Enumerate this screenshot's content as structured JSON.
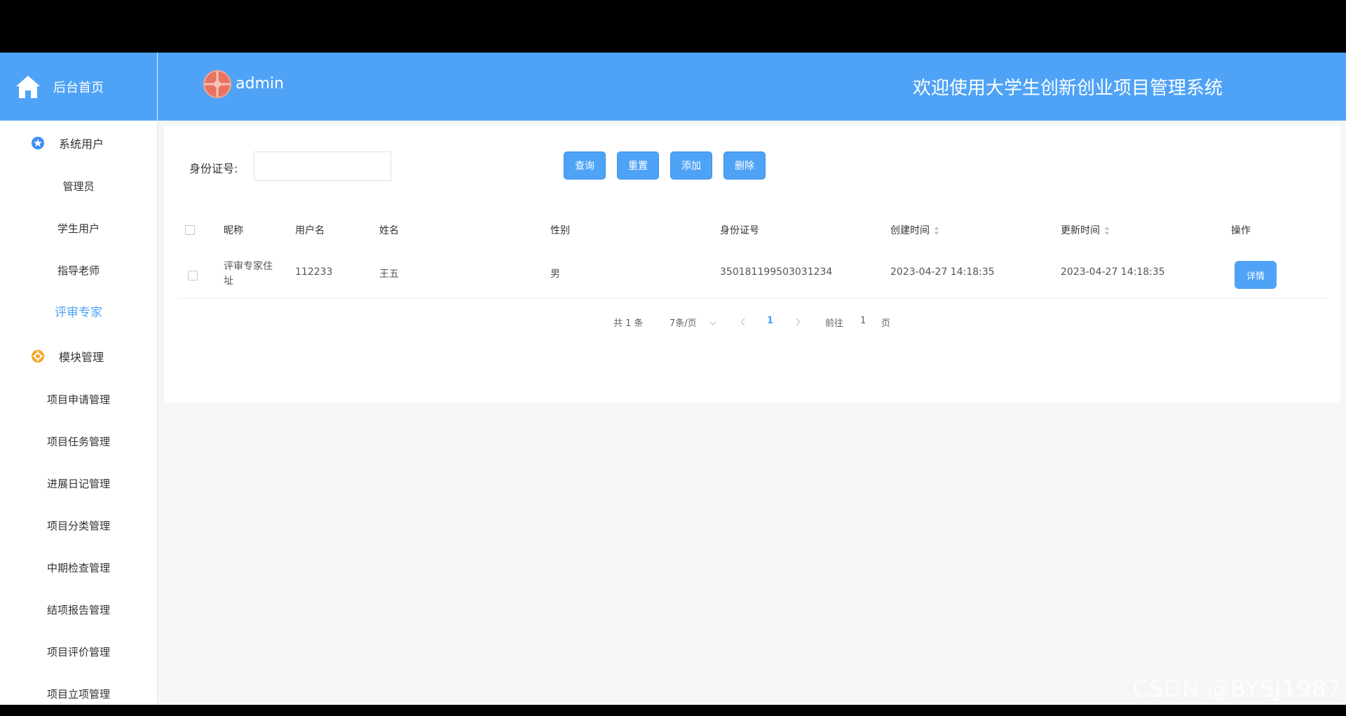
{
  "header": {
    "home_label": "后台首页",
    "username": "admin",
    "site_title": "欢迎使用大学生创新创业项目管理系统"
  },
  "sidebar": {
    "groups": [
      {
        "label": "系统用户",
        "items": [
          "管理员",
          "学生用户",
          "指导老师",
          "评审专家"
        ]
      },
      {
        "label": "模块管理",
        "items": [
          "项目申请管理",
          "项目任务管理",
          "进展日记管理",
          "项目分类管理",
          "中期检查管理",
          "结项报告管理",
          "项目评价管理",
          "项目立项管理"
        ]
      }
    ],
    "active_item": "评审专家"
  },
  "search": {
    "label": "身份证号:",
    "value": "",
    "placeholder": ""
  },
  "toolbar": {
    "query": "查询",
    "reset": "重置",
    "add": "添加",
    "delete": "删除"
  },
  "table": {
    "columns": [
      "昵称",
      "用户名",
      "姓名",
      "性别",
      "身份证号",
      "创建时间",
      "更新时间",
      "操作"
    ],
    "rows": [
      {
        "nickname_line1": "评审专家住",
        "nickname_line2": "址",
        "username": "112233",
        "name": "王五",
        "gender": "男",
        "id_number": "350181199503031234",
        "created": "2023-04-27 14:18:35",
        "updated": "2023-04-27 14:18:35",
        "action": "详情"
      }
    ]
  },
  "pagination": {
    "total": "共 1 条",
    "page_size": "7条/页",
    "current": "1",
    "goto_label": "前往",
    "goto_value": "1",
    "page_suffix": "页"
  },
  "watermark": "CSDN @BYSJ1987",
  "colors": {
    "primary": "#4fa3f7",
    "header_bg": "#4fa3f7",
    "active": "#4fa3f7"
  }
}
